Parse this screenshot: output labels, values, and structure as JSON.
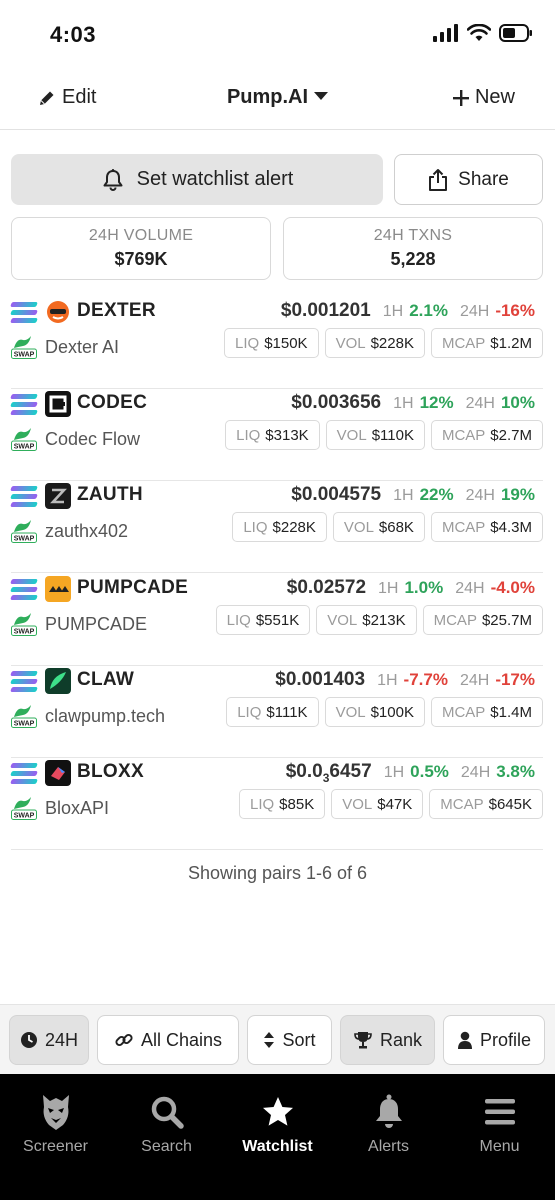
{
  "status_bar": {
    "time": "4:03"
  },
  "header": {
    "edit_label": "Edit",
    "title": "Pump.AI",
    "new_label": "New"
  },
  "actions": {
    "alert_label": "Set watchlist alert",
    "share_label": "Share"
  },
  "stats": {
    "volume_label": "24H VOLUME",
    "volume_value": "$769K",
    "txns_label": "24H TXNS",
    "txns_value": "5,228"
  },
  "labels": {
    "h1": "1H",
    "h24": "24H",
    "liq": "LIQ",
    "vol": "VOL",
    "mcap": "MCAP"
  },
  "pairs": [
    {
      "symbol": "DEXTER",
      "name": "Dexter AI",
      "price": "$0.001201",
      "change_1h": "2.1%",
      "change_24h": "-16%",
      "liq": "$150K",
      "vol": "$228K",
      "mcap": "$1.2M",
      "logo_color": "#ffffff",
      "change_1h_dir": "up",
      "change_24h_dir": "down"
    },
    {
      "symbol": "CODEC",
      "name": "Codec Flow",
      "price": "$0.003656",
      "change_1h": "12%",
      "change_24h": "10%",
      "liq": "$313K",
      "vol": "$110K",
      "mcap": "$2.7M",
      "logo_color": "#111111",
      "change_1h_dir": "up",
      "change_24h_dir": "up"
    },
    {
      "symbol": "ZAUTH",
      "name": "zauthx402",
      "price": "$0.004575",
      "change_1h": "22%",
      "change_24h": "19%",
      "liq": "$228K",
      "vol": "$68K",
      "mcap": "$4.3M",
      "logo_color": "#1a1a1a",
      "change_1h_dir": "up",
      "change_24h_dir": "up"
    },
    {
      "symbol": "PUMPCADE",
      "name": "PUMPCADE",
      "price": "$0.02572",
      "change_1h": "1.0%",
      "change_24h": "-4.0%",
      "liq": "$551K",
      "vol": "$213K",
      "mcap": "$25.7M",
      "logo_color": "#f5a623",
      "change_1h_dir": "up",
      "change_24h_dir": "down"
    },
    {
      "symbol": "CLAW",
      "name": "clawpump.tech",
      "price": "$0.001403",
      "change_1h": "-7.7%",
      "change_24h": "-17%",
      "liq": "$111K",
      "vol": "$100K",
      "mcap": "$1.4M",
      "logo_color": "#0f3d2a",
      "change_1h_dir": "down",
      "change_24h_dir": "down"
    },
    {
      "symbol": "BLOXX",
      "name": "BloxAPI",
      "price_main": "$0.0",
      "price_sub": "3",
      "price_rest": "6457",
      "change_1h": "0.5%",
      "change_24h": "3.8%",
      "liq": "$85K",
      "vol": "$47K",
      "mcap": "$645K",
      "logo_color": "#111111",
      "change_1h_dir": "up",
      "change_24h_dir": "up"
    }
  ],
  "footer_note": "Showing pairs 1-6 of 6",
  "filters": {
    "timeframe": "24H",
    "chains": "All Chains",
    "sort": "Sort",
    "rank": "Rank",
    "profile": "Profile"
  },
  "tabs": {
    "screener": "Screener",
    "search": "Search",
    "watchlist": "Watchlist",
    "alerts": "Alerts",
    "menu": "Menu"
  },
  "colors": {
    "up": "#2ea35a",
    "down": "#e0423a",
    "tab_bar_bg": "#000000"
  }
}
